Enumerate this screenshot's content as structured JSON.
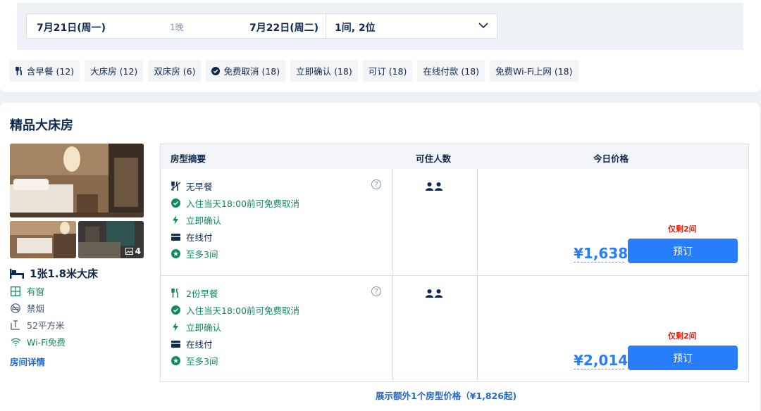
{
  "search": {
    "checkin": "7月21日(周一)",
    "nights": "1晚",
    "checkout": "7月22日(周二)",
    "guests": "1间, 2位"
  },
  "filters": [
    {
      "label": "含早餐 (12)",
      "icon": "utensils-icon"
    },
    {
      "label": "大床房 (12)"
    },
    {
      "label": "双床房 (6)"
    },
    {
      "label": "免费取消 (18)",
      "icon": "check-circle-icon"
    },
    {
      "label": "立即确认 (18)"
    },
    {
      "label": "可订 (18)"
    },
    {
      "label": "在线付款 (18)"
    },
    {
      "label": "免费Wi-Fi上网 (18)"
    }
  ],
  "room": {
    "title": "精品大床房",
    "photo_count": "4",
    "bed": "1张1.8米大床",
    "features": {
      "window": "有窗",
      "smoking": "禁烟",
      "area": "52平方米",
      "wifi": "Wi-Fi免费"
    },
    "detail_link": "房间详情"
  },
  "table": {
    "headers": [
      "房型摘要",
      "可住人数",
      "今日价格"
    ],
    "rows": [
      {
        "meal": "无早餐",
        "cancel": "入住当天18:00前可免费取消",
        "confirm": "立即确认",
        "pay": "在线付",
        "limit": "至多3间",
        "remain": "仅剩2间",
        "price": "¥1,638",
        "book": "预订"
      },
      {
        "meal": "2份早餐",
        "cancel": "入住当天18:00前可免费取消",
        "confirm": "立即确认",
        "pay": "在线付",
        "limit": "至多3间",
        "remain": "仅剩2间",
        "price": "¥2,014",
        "book": "预订"
      }
    ]
  },
  "more_link": "展示额外1个房型价格（¥1,826起)",
  "colors": {
    "accent": "#287dfa",
    "green": "#0f8a5f",
    "alert": "#e1230e",
    "text": "#0f294d"
  }
}
